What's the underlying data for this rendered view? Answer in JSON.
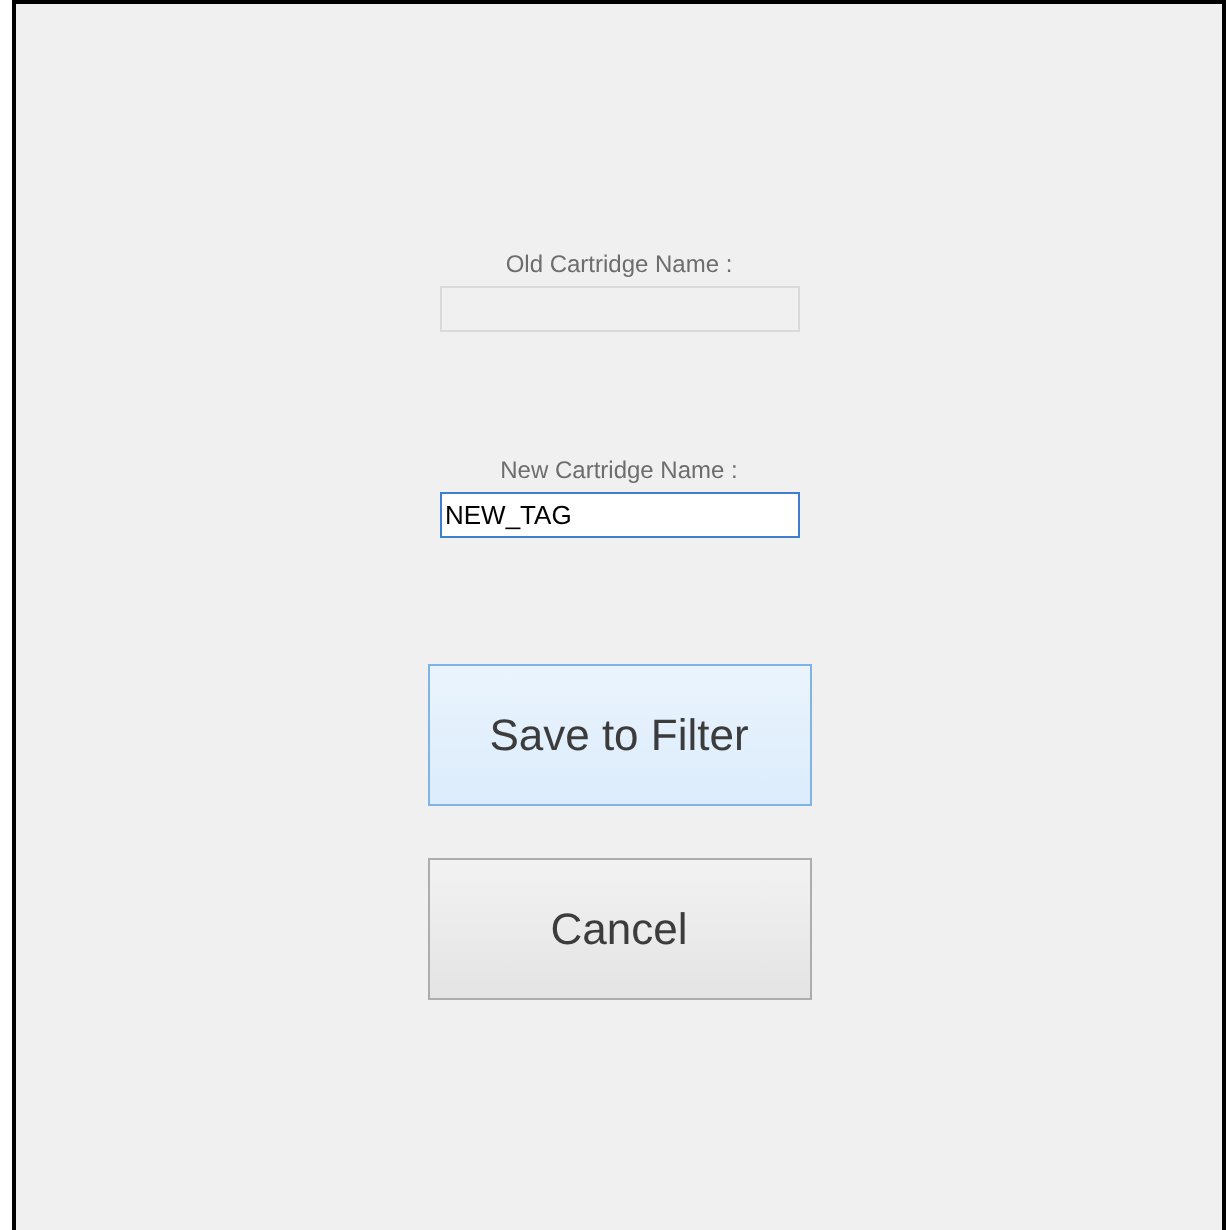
{
  "fields": [
    {
      "label": "Old Cartridge Name :",
      "disabled": true,
      "focused": false
    },
    {
      "label": "New Cartridge Name :",
      "value": "NEW_TAG",
      "disabled": false,
      "focused": true
    }
  ],
  "buttons": [
    {
      "label": "Save to Filter",
      "highlighted": true
    },
    {
      "label": "Cancel",
      "highlighted": false
    }
  ]
}
